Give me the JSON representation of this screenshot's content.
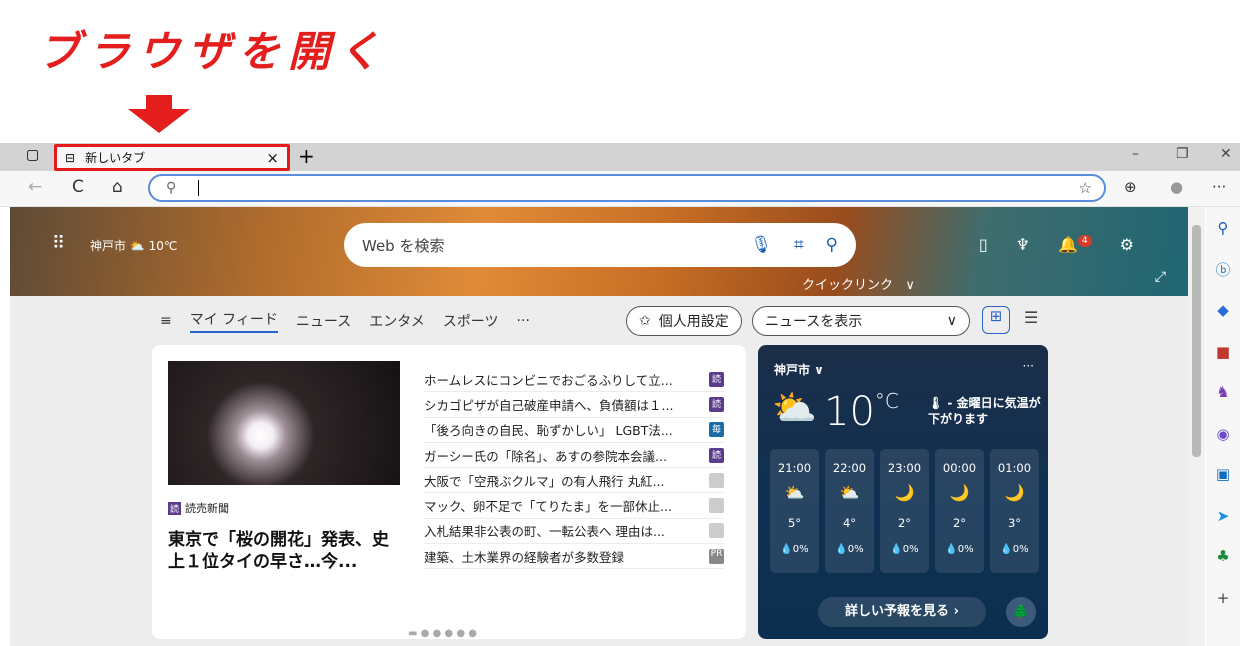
{
  "heading": "ブラウザを開く",
  "tab": {
    "title": "新しいタブ",
    "close": "×",
    "new": "+"
  },
  "window": {
    "minimize": "–",
    "restore": "❐",
    "close": "✕"
  },
  "nav": {
    "back": "←",
    "refresh": "C",
    "home": "⌂",
    "more": "···"
  },
  "address": {
    "value": ""
  },
  "hero": {
    "city": "神戸市",
    "temp": "10℃",
    "search_placeholder": "Web を検索",
    "notifications": "4",
    "quicklinks": "クイックリンク",
    "quicklinks_caret": "∨"
  },
  "feed": {
    "menu": "≡",
    "tabs": [
      "マイ フィード",
      "ニュース",
      "エンタメ",
      "スポーツ",
      "···"
    ],
    "personalize": "個人用設定",
    "news_select": "ニュースを表示",
    "select_caret": "∨"
  },
  "main_story": {
    "source": "読売新聞",
    "headline": "東京で「桜の開花」発表、史上１位タイの早さ…今..."
  },
  "news": [
    {
      "title": "ホームレスにコンビニでおごるふりして立...",
      "badge": "読",
      "color": "#5b3b8c"
    },
    {
      "title": "シカゴピザが自己破産申請へ、負債額は１...",
      "badge": "読",
      "color": "#5b3b8c"
    },
    {
      "title": "「後ろ向きの自民、恥ずかしい」 LGBT法...",
      "badge": "毎",
      "color": "#1a6ca8"
    },
    {
      "title": "ガーシー氏の「除名」、あすの参院本会議...",
      "badge": "読",
      "color": "#5b3b8c"
    },
    {
      "title": "大阪で「空飛ぶクルマ」の有人飛行 丸紅...",
      "badge": "",
      "color": "#cccccc"
    },
    {
      "title": "マック、卵不足で「てりたま」を一部休止...",
      "badge": "",
      "color": "#cccccc"
    },
    {
      "title": "入札結果非公表の町、一転公表へ 理由は...",
      "badge": "",
      "color": "#cccccc"
    },
    {
      "title": "建築、土木業界の経験者が多数登録",
      "badge": "PR",
      "color": "#888888"
    }
  ],
  "weather": {
    "city": "神戸市 ∨",
    "temp": "10",
    "unit": "°C",
    "alert": "- 金曜日に気温が下がります",
    "hours": [
      {
        "time": "21:00",
        "icon": "⛅",
        "temp": "5°",
        "precip": "0%"
      },
      {
        "time": "22:00",
        "icon": "⛅",
        "temp": "4°",
        "precip": "0%"
      },
      {
        "time": "23:00",
        "icon": "🌙",
        "temp": "2°",
        "precip": "0%"
      },
      {
        "time": "00:00",
        "icon": "🌙",
        "temp": "2°",
        "precip": "0%"
      },
      {
        "time": "01:00",
        "icon": "🌙",
        "temp": "3°",
        "precip": "0%"
      }
    ],
    "forecast_button": "詳しい予報を見る ›"
  }
}
